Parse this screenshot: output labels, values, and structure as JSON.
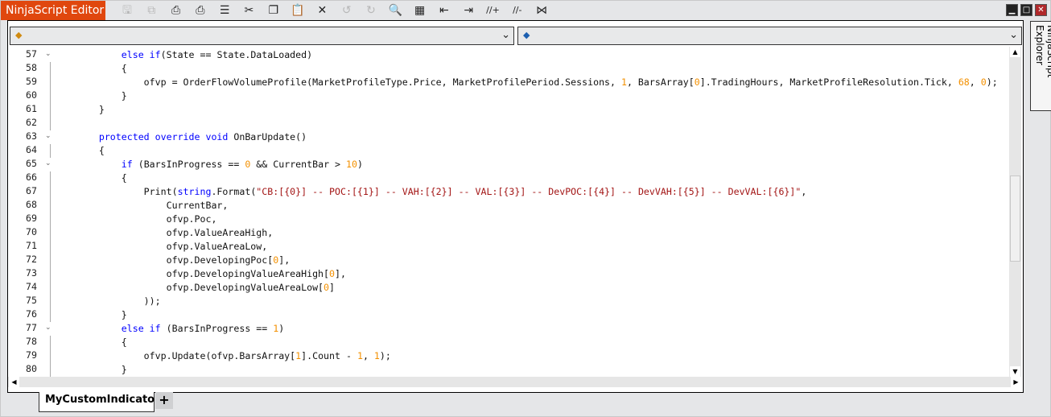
{
  "app": {
    "title": "NinjaScript Editor",
    "accent": "#e0470e"
  },
  "toolbar": [
    {
      "icon": "save-icon",
      "glyph": "🖫",
      "enabled": false
    },
    {
      "icon": "save-all-icon",
      "glyph": "⧉",
      "enabled": false
    },
    {
      "icon": "print-icon",
      "glyph": "⎙",
      "enabled": true
    },
    {
      "icon": "print-preview-icon",
      "glyph": "⎙",
      "enabled": true
    },
    {
      "icon": "properties-icon",
      "glyph": "☰",
      "enabled": true
    },
    {
      "icon": "cut-icon",
      "glyph": "✂",
      "enabled": true
    },
    {
      "icon": "copy-icon",
      "glyph": "❐",
      "enabled": true
    },
    {
      "icon": "paste-icon",
      "glyph": "📋",
      "enabled": true
    },
    {
      "icon": "delete-icon",
      "glyph": "✕",
      "enabled": true
    },
    {
      "icon": "undo-icon",
      "glyph": "↺",
      "enabled": false
    },
    {
      "icon": "redo-icon",
      "glyph": "↻",
      "enabled": false
    },
    {
      "icon": "find-icon",
      "glyph": "🔍",
      "enabled": true
    },
    {
      "icon": "insert-snippet-icon",
      "glyph": "▦",
      "enabled": true
    },
    {
      "icon": "outdent-icon",
      "glyph": "⇤",
      "enabled": true
    },
    {
      "icon": "indent-icon",
      "glyph": "⇥",
      "enabled": true
    },
    {
      "icon": "comment-icon",
      "glyph": "//+",
      "enabled": true
    },
    {
      "icon": "uncomment-icon",
      "glyph": "//-",
      "enabled": true
    },
    {
      "icon": "visual-studio-icon",
      "glyph": "⋈",
      "enabled": true
    }
  ],
  "window": {
    "minimize": "▁",
    "maximize": "□",
    "close": "✕"
  },
  "dropdowns": {
    "left": {
      "value": ""
    },
    "right": {
      "value": ""
    }
  },
  "code": [
    {
      "n": "57",
      "fold": "v",
      "t": [
        [
          "t",
          "            "
        ],
        [
          "k",
          "else if"
        ],
        [
          "t",
          "(State == State.DataLoaded)"
        ]
      ]
    },
    {
      "n": "58",
      "t": [
        [
          "t",
          "            {"
        ]
      ]
    },
    {
      "n": "59",
      "t": [
        [
          "t",
          "                ofvp = OrderFlowVolumeProfile(MarketProfileType.Price, MarketProfilePeriod.Sessions, "
        ],
        [
          "n",
          "1"
        ],
        [
          "t",
          ", BarsArray["
        ],
        [
          "n",
          "0"
        ],
        [
          "t",
          "].TradingHours, MarketProfileResolution.Tick, "
        ],
        [
          "n",
          "68"
        ],
        [
          "t",
          ", "
        ],
        [
          "n",
          "0"
        ],
        [
          "t",
          ");"
        ]
      ]
    },
    {
      "n": "60",
      "t": [
        [
          "t",
          "            }"
        ]
      ]
    },
    {
      "n": "61",
      "t": [
        [
          "t",
          "        }"
        ]
      ]
    },
    {
      "n": "62",
      "t": []
    },
    {
      "n": "63",
      "fold": "v",
      "t": [
        [
          "t",
          "        "
        ],
        [
          "k",
          "protected override void"
        ],
        [
          "t",
          " OnBarUpdate()"
        ]
      ]
    },
    {
      "n": "64",
      "t": [
        [
          "t",
          "        {"
        ]
      ]
    },
    {
      "n": "65",
      "fold": "v",
      "t": [
        [
          "t",
          "            "
        ],
        [
          "k",
          "if"
        ],
        [
          "t",
          " (BarsInProgress == "
        ],
        [
          "n",
          "0"
        ],
        [
          "t",
          " && CurrentBar > "
        ],
        [
          "n",
          "10"
        ],
        [
          "t",
          ")"
        ]
      ]
    },
    {
      "n": "66",
      "t": [
        [
          "t",
          "            {"
        ]
      ]
    },
    {
      "n": "67",
      "t": [
        [
          "t",
          "                Print("
        ],
        [
          "k",
          "string"
        ],
        [
          "t",
          ".Format("
        ],
        [
          "s",
          "\"CB:[{0}] -- POC:[{1}] -- VAH:[{2}] -- VAL:[{3}] -- DevPOC:[{4}] -- DevVAH:[{5}] -- DevVAL:[{6}]\""
        ],
        [
          "t",
          ","
        ]
      ]
    },
    {
      "n": "68",
      "t": [
        [
          "t",
          "                    CurrentBar,"
        ]
      ]
    },
    {
      "n": "69",
      "t": [
        [
          "t",
          "                    ofvp.Poc,"
        ]
      ]
    },
    {
      "n": "70",
      "t": [
        [
          "t",
          "                    ofvp.ValueAreaHigh,"
        ]
      ]
    },
    {
      "n": "71",
      "t": [
        [
          "t",
          "                    ofvp.ValueAreaLow,"
        ]
      ]
    },
    {
      "n": "72",
      "t": [
        [
          "t",
          "                    ofvp.DevelopingPoc["
        ],
        [
          "n",
          "0"
        ],
        [
          "t",
          "],"
        ]
      ]
    },
    {
      "n": "73",
      "t": [
        [
          "t",
          "                    ofvp.DevelopingValueAreaHigh["
        ],
        [
          "n",
          "0"
        ],
        [
          "t",
          "],"
        ]
      ]
    },
    {
      "n": "74",
      "t": [
        [
          "t",
          "                    ofvp.DevelopingValueAreaLow["
        ],
        [
          "n",
          "0"
        ],
        [
          "t",
          "]"
        ]
      ]
    },
    {
      "n": "75",
      "t": [
        [
          "t",
          "                ));"
        ]
      ]
    },
    {
      "n": "76",
      "t": [
        [
          "t",
          "            }"
        ]
      ]
    },
    {
      "n": "77",
      "fold": "v",
      "t": [
        [
          "t",
          "            "
        ],
        [
          "k",
          "else if"
        ],
        [
          "t",
          " (BarsInProgress == "
        ],
        [
          "n",
          "1"
        ],
        [
          "t",
          ")"
        ]
      ]
    },
    {
      "n": "78",
      "t": [
        [
          "t",
          "            {"
        ]
      ]
    },
    {
      "n": "79",
      "t": [
        [
          "t",
          "                ofvp.Update(ofvp.BarsArray["
        ],
        [
          "n",
          "1"
        ],
        [
          "t",
          "].Count - "
        ],
        [
          "n",
          "1"
        ],
        [
          "t",
          ", "
        ],
        [
          "n",
          "1"
        ],
        [
          "t",
          ");"
        ]
      ]
    },
    {
      "n": "80",
      "t": [
        [
          "t",
          "            }"
        ]
      ]
    }
  ],
  "tabs": [
    {
      "label": "MyCustomIndicator",
      "active": true
    }
  ],
  "add_tab": "+",
  "side_panel": {
    "label": "NinjaScript Explorer"
  }
}
